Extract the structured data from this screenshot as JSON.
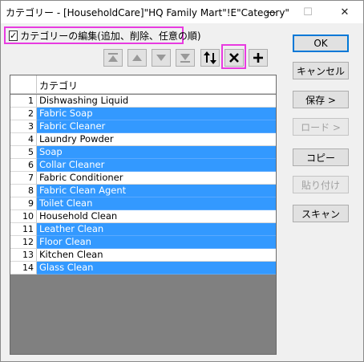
{
  "window": {
    "title": "カテゴリー - [HouseholdCare]\"HQ Family Mart\"!E\"Category\"",
    "minimize_glyph": "—",
    "maximize_glyph": "☐",
    "close_glyph": "✕"
  },
  "edit_checkbox": {
    "label": "カテゴリーの編集(追加、削除、任意の順)",
    "checked": true,
    "check_glyph": "✓"
  },
  "toolbar": {
    "icons": [
      "move-top-icon",
      "move-up-icon",
      "move-down-icon",
      "move-bottom-icon",
      "sort-icon",
      "delete-icon",
      "add-icon"
    ]
  },
  "grid": {
    "column_header": "カテゴリ",
    "rows": [
      {
        "num": "1",
        "value": "Dishwashing Liquid",
        "selected": false
      },
      {
        "num": "2",
        "value": "Fabric Soap",
        "selected": true
      },
      {
        "num": "3",
        "value": "Fabric Cleaner",
        "selected": true
      },
      {
        "num": "4",
        "value": "Laundry Powder",
        "selected": false
      },
      {
        "num": "5",
        "value": "Soap",
        "selected": true
      },
      {
        "num": "6",
        "value": "Collar Cleaner",
        "selected": true
      },
      {
        "num": "7",
        "value": "Fabric Conditioner",
        "selected": false
      },
      {
        "num": "8",
        "value": "Fabric Clean Agent",
        "selected": true
      },
      {
        "num": "9",
        "value": "Toilet Clean",
        "selected": true
      },
      {
        "num": "10",
        "value": "Household Clean",
        "selected": false
      },
      {
        "num": "11",
        "value": "Leather Clean",
        "selected": true
      },
      {
        "num": "12",
        "value": "Floor Clean",
        "selected": true
      },
      {
        "num": "13",
        "value": "Kitchen Clean",
        "selected": false
      },
      {
        "num": "14",
        "value": "Glass Clean",
        "selected": true
      }
    ]
  },
  "buttons": {
    "ok": "OK",
    "cancel": "キャンセル",
    "save": "保存 >",
    "load": "ロード >",
    "copy": "コピー",
    "paste": "貼り付け",
    "scan": "スキャン"
  },
  "colors": {
    "selection": "#3399ff",
    "highlight": "#e83be0",
    "default_button_border": "#0078d7"
  }
}
